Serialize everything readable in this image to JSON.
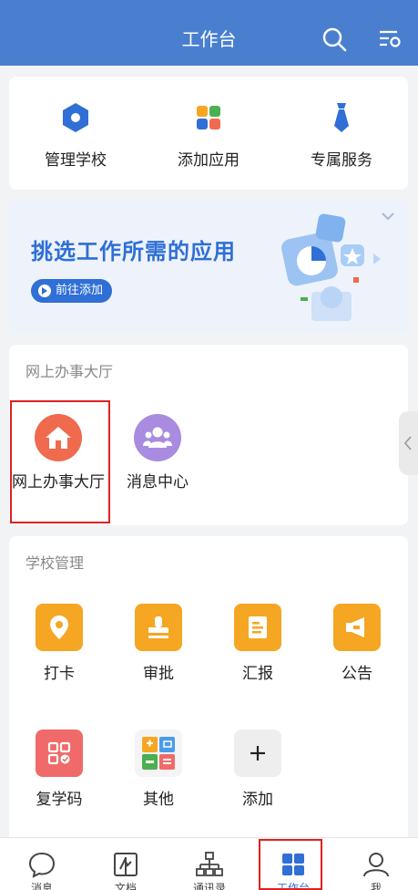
{
  "header": {
    "title": "工作台"
  },
  "quick_actions": [
    {
      "label": "管理学校",
      "icon": "hexagon-icon"
    },
    {
      "label": "添加应用",
      "icon": "app-grid-icon"
    },
    {
      "label": "专属服务",
      "icon": "tie-icon"
    }
  ],
  "banner": {
    "title": "挑选工作所需的应用",
    "button": "前往添加"
  },
  "online_hall": {
    "title": "网上办事大厅",
    "apps": [
      {
        "label": "网上办事大厅",
        "icon": "home-icon",
        "color": "#f06a4e"
      },
      {
        "label": "消息中心",
        "icon": "people-icon",
        "color": "#a98be0"
      }
    ]
  },
  "school_mgmt": {
    "title": "学校管理",
    "apps": [
      {
        "label": "打卡",
        "icon": "location-pin-icon",
        "color": "#f5a623"
      },
      {
        "label": "审批",
        "icon": "stamp-icon",
        "color": "#f5a623"
      },
      {
        "label": "汇报",
        "icon": "report-icon",
        "color": "#f5a623"
      },
      {
        "label": "公告",
        "icon": "megaphone-icon",
        "color": "#f5a623"
      },
      {
        "label": "复学码",
        "icon": "qr-code-icon",
        "color": "#f06a6a"
      },
      {
        "label": "其他",
        "icon": "multi-app-icon",
        "color": "#f0f0f0"
      },
      {
        "label": "添加",
        "icon": "plus-icon",
        "color": "#eeeeee"
      }
    ]
  },
  "tabbar": {
    "tabs": [
      {
        "label": "消息",
        "icon": "chat-bubble-icon"
      },
      {
        "label": "文档",
        "icon": "document-icon"
      },
      {
        "label": "通讯录",
        "icon": "org-chart-icon"
      },
      {
        "label": "工作台",
        "icon": "workbench-grid-icon",
        "active": true
      },
      {
        "label": "我",
        "icon": "person-icon"
      }
    ]
  },
  "colors": {
    "primary": "#4a7fd0",
    "active_tab": "#2f6fd6",
    "highlight": "#e02020"
  }
}
